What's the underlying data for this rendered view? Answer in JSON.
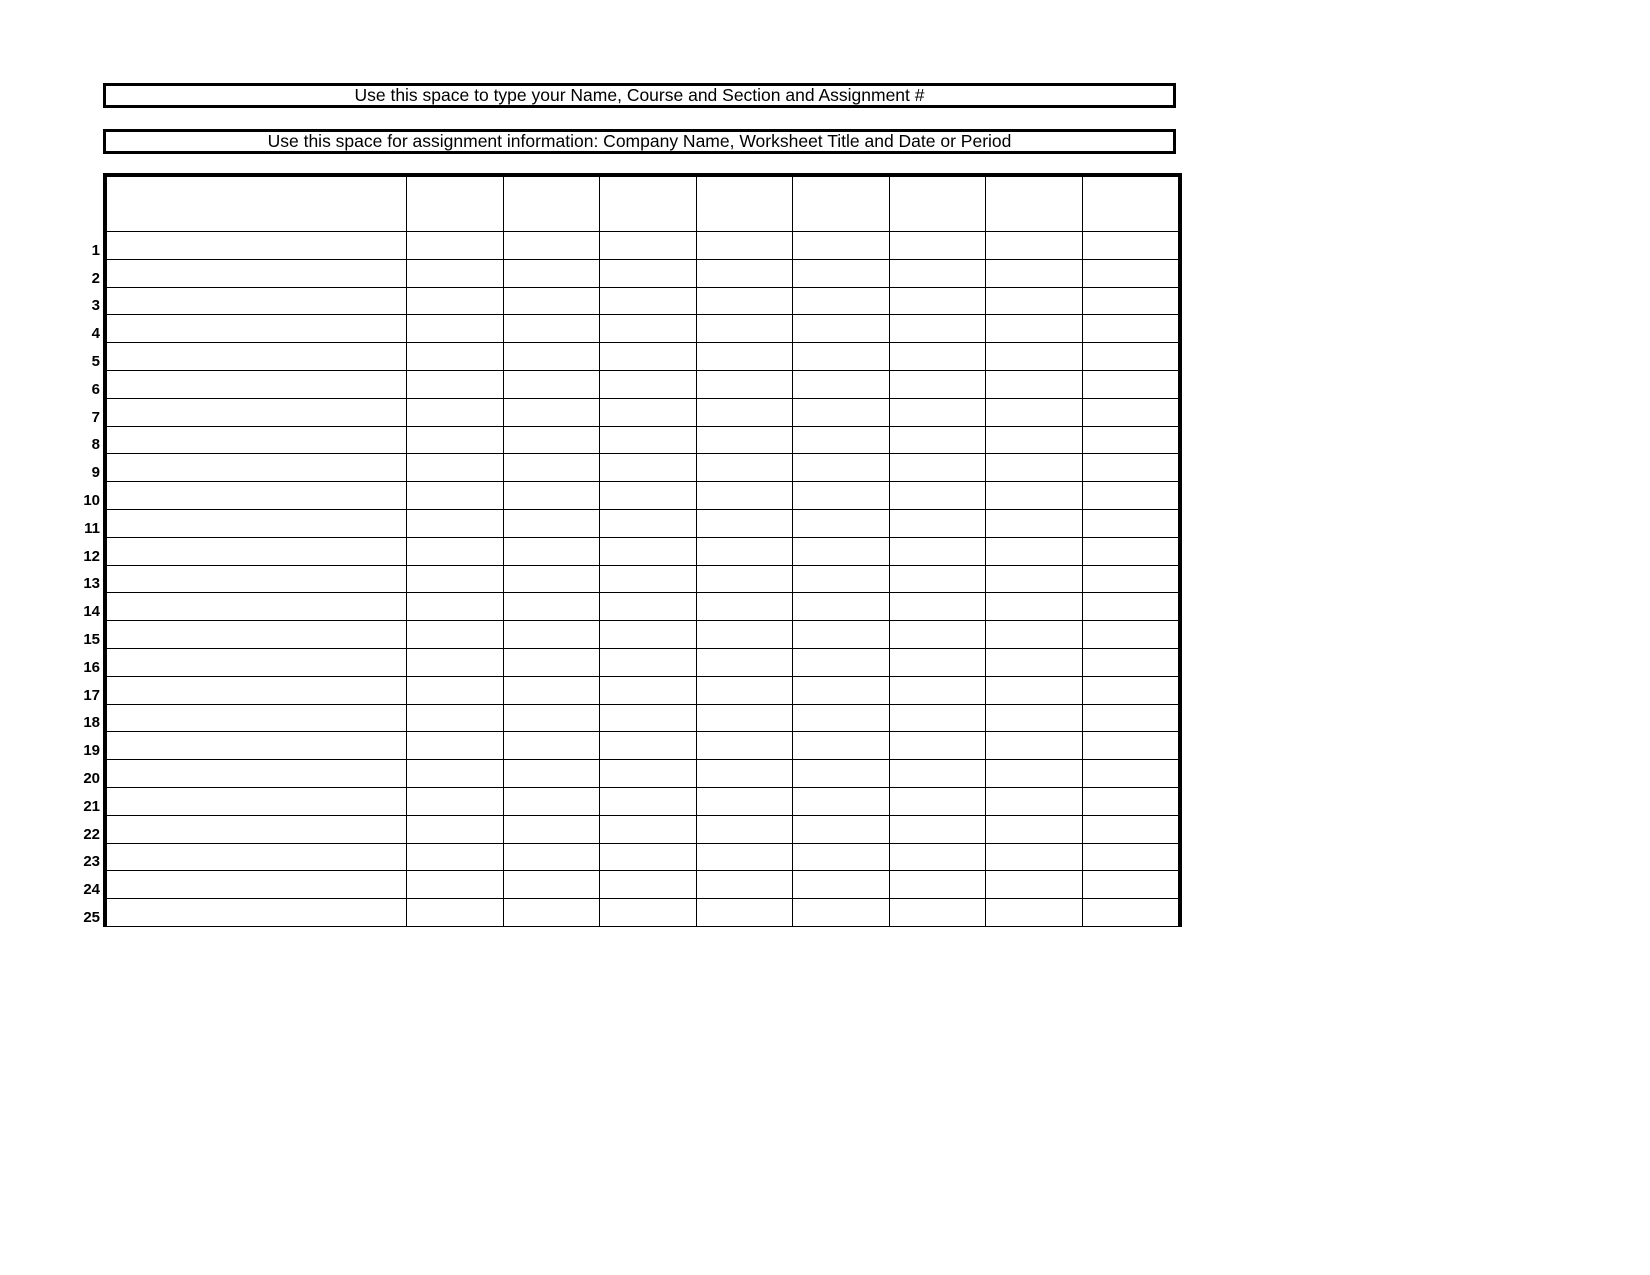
{
  "banners": {
    "line1": "Use this space to type your Name, Course and Section and Assignment #",
    "line2": "Use this space for assignment information: Company Name, Worksheet Title and Date or Period"
  },
  "grid": {
    "columns": 9,
    "visible_rows": 25,
    "row_labels": [
      "1",
      "2",
      "3",
      "4",
      "5",
      "6",
      "7",
      "8",
      "9",
      "10",
      "11",
      "12",
      "13",
      "14",
      "15",
      "16",
      "17",
      "18",
      "19",
      "20",
      "21",
      "22",
      "23",
      "24",
      "25"
    ]
  }
}
